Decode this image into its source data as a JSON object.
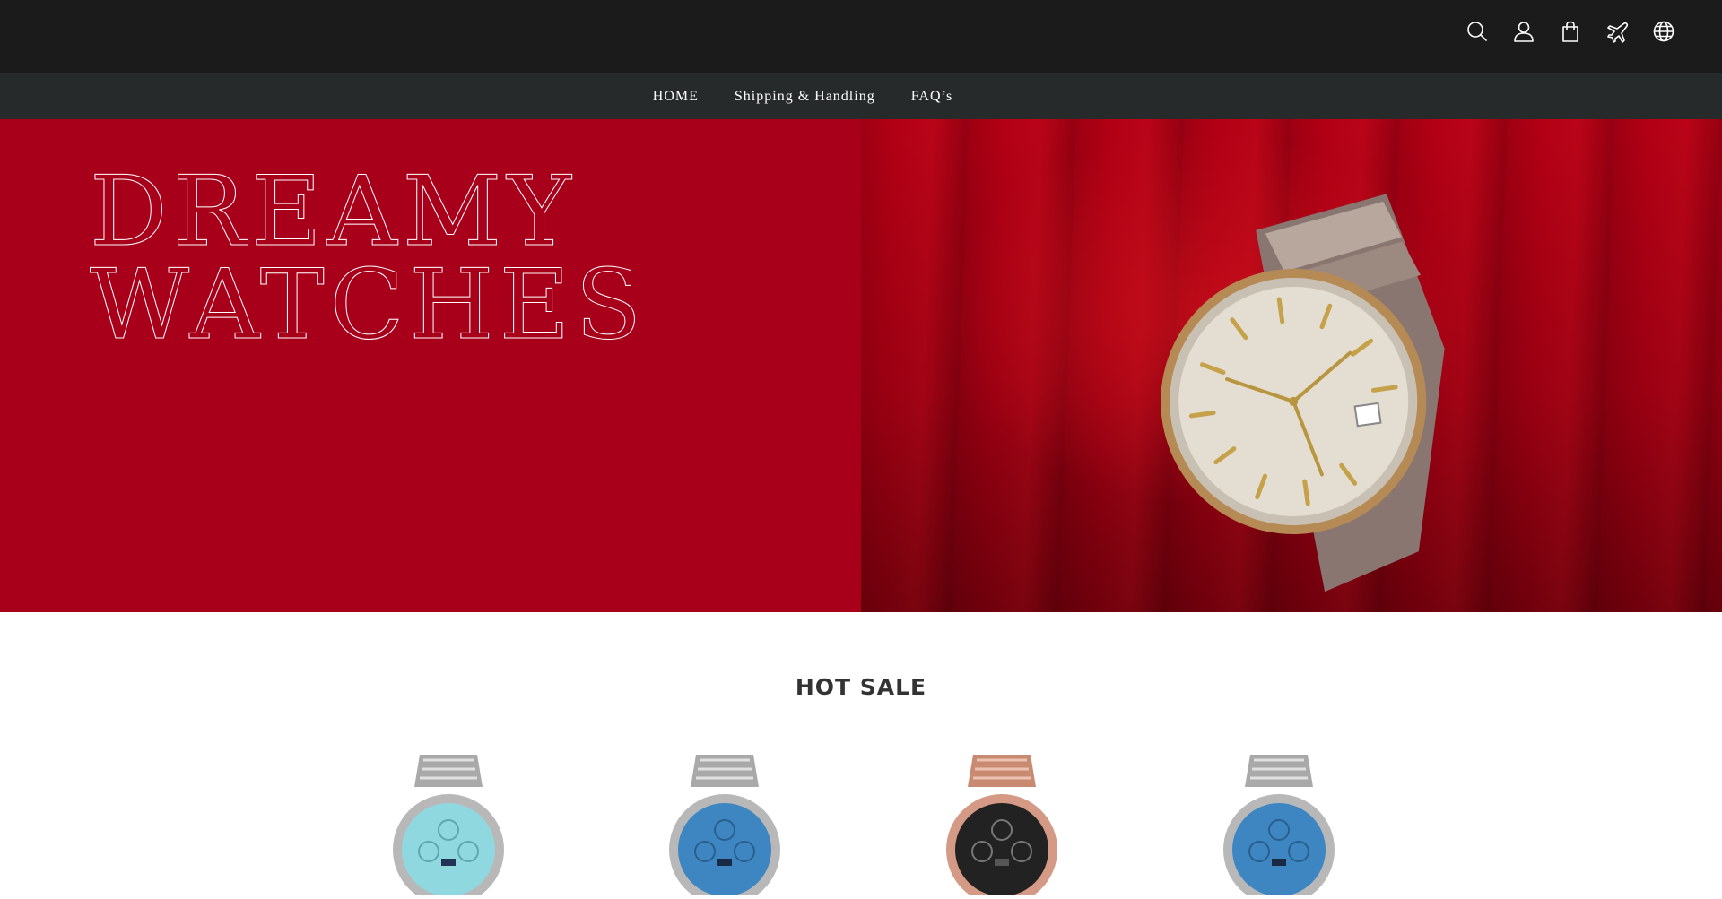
{
  "header": {
    "icons": [
      "search-icon",
      "account-icon",
      "bag-icon",
      "plane-icon",
      "globe-icon"
    ]
  },
  "nav": {
    "items": [
      {
        "label": "HOME"
      },
      {
        "label": "Shipping & Handling"
      },
      {
        "label": "FAQ’s"
      }
    ]
  },
  "hero": {
    "line1": "DREAMY",
    "line2": "WATCHES",
    "background_color": "#a8001a"
  },
  "hot_sale": {
    "title": "HOT SALE",
    "products": [
      {
        "dial_color": "#8fd8e0",
        "case_color": "#b8b8b8"
      },
      {
        "dial_color": "#3d86c2",
        "case_color": "#b8b8b8"
      },
      {
        "dial_color": "#222222",
        "case_color": "#d49a85"
      },
      {
        "dial_color": "#3d86c2",
        "case_color": "#b8b8b8"
      }
    ]
  }
}
